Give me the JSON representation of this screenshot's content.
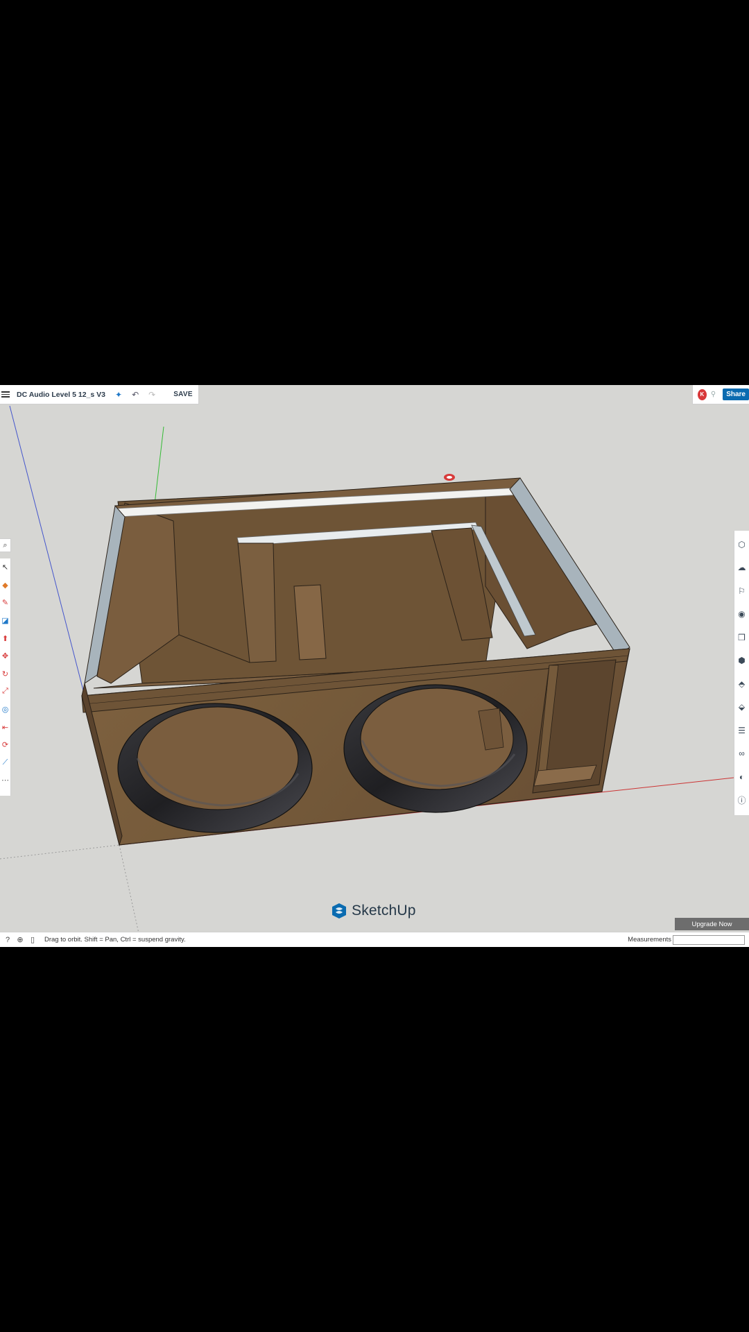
{
  "app": {
    "document_title": "DC Audio Level 5 12_s V3",
    "save_label": "SAVE",
    "share_label": "Share",
    "avatar_initial": "K",
    "logo_text": "SketchUp",
    "upgrade_label": "Upgrade Now"
  },
  "toolbar_icons": {
    "menu": "hamburger-icon",
    "ai": "sparkle-icon",
    "undo": "undo-icon",
    "redo": "redo-icon"
  },
  "left_tools": [
    {
      "name": "select-tool",
      "glyph": "↖",
      "color": "#333333"
    },
    {
      "name": "eraser-tool",
      "glyph": "◆",
      "color": "#e07b2a"
    },
    {
      "name": "pencil-tool",
      "glyph": "✎",
      "color": "#d83b3b"
    },
    {
      "name": "rectangle-tool",
      "glyph": "◪",
      "color": "#1f78c8"
    },
    {
      "name": "push-pull-tool",
      "glyph": "⬆",
      "color": "#d83b3b"
    },
    {
      "name": "move-tool",
      "glyph": "✥",
      "color": "#d83b3b"
    },
    {
      "name": "rotate-tool",
      "glyph": "↻",
      "color": "#d83b3b"
    },
    {
      "name": "scale-tool",
      "glyph": "⤢",
      "color": "#d83b3b"
    },
    {
      "name": "offset-tool",
      "glyph": "◎",
      "color": "#1f78c8"
    },
    {
      "name": "tape-measure-tool",
      "glyph": "⇤",
      "color": "#d83b3b"
    },
    {
      "name": "orbit-tool",
      "glyph": "⟳",
      "color": "#d83b3b"
    },
    {
      "name": "section-tool",
      "glyph": "⟋",
      "color": "#1f78c8"
    },
    {
      "name": "more-tools",
      "glyph": "⋯",
      "color": "#555555"
    }
  ],
  "right_tools": [
    {
      "name": "entity-info-icon",
      "glyph": "⬡"
    },
    {
      "name": "instructor-icon",
      "glyph": "☁"
    },
    {
      "name": "components-icon",
      "glyph": "⚐"
    },
    {
      "name": "materials-icon",
      "glyph": "◉"
    },
    {
      "name": "styles-icon",
      "glyph": "❒"
    },
    {
      "name": "tags-icon",
      "glyph": "⬢"
    },
    {
      "name": "scenes-icon",
      "glyph": "⬘"
    },
    {
      "name": "display-icon",
      "glyph": "⬙"
    },
    {
      "name": "outliner-icon",
      "glyph": "☰"
    },
    {
      "name": "solid-tools-icon",
      "glyph": "∞"
    },
    {
      "name": "shadows-icon",
      "glyph": "◐"
    },
    {
      "name": "info-icon",
      "glyph": "ⓘ"
    }
  ],
  "status_bar": {
    "hint": "Drag to orbit. Shift = Pan, Ctrl = suspend gravity.",
    "measurements_label": "Measurements",
    "measurements_value": ""
  },
  "colors": {
    "viewport_bg": "#d6d6d3",
    "wood": "#7a5e3d",
    "share_blue": "#0a6bb0",
    "axis_red": "#cc3333",
    "axis_green": "#33bb33",
    "axis_blue": "#4455cc"
  }
}
